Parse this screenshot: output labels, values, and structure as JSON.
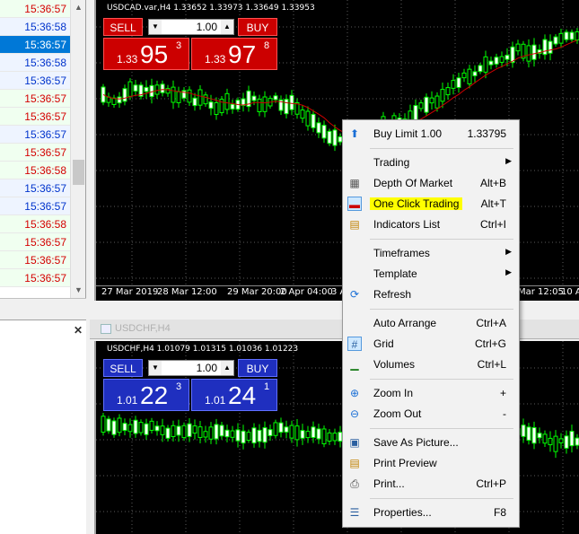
{
  "time_list": [
    {
      "time": "15:36:57",
      "color": "red"
    },
    {
      "time": "15:36:58",
      "color": "blue"
    },
    {
      "time": "15:36:57",
      "color": "selected"
    },
    {
      "time": "15:36:58",
      "color": "blue"
    },
    {
      "time": "15:36:57",
      "color": "blue"
    },
    {
      "time": "15:36:57",
      "color": "red"
    },
    {
      "time": "15:36:57",
      "color": "red"
    },
    {
      "time": "15:36:57",
      "color": "blue"
    },
    {
      "time": "15:36:57",
      "color": "red"
    },
    {
      "time": "15:36:58",
      "color": "red"
    },
    {
      "time": "15:36:57",
      "color": "blue"
    },
    {
      "time": "15:36:57",
      "color": "blue"
    },
    {
      "time": "15:36:58",
      "color": "red"
    },
    {
      "time": "15:36:57",
      "color": "red"
    },
    {
      "time": "15:36:57",
      "color": "red"
    },
    {
      "time": "15:36:57",
      "color": "red"
    }
  ],
  "chart1": {
    "title": "USDCAD.var,H4  1.33652 1.33973 1.33649 1.33953",
    "sell_label": "SELL",
    "buy_label": "BUY",
    "lots": "1.00",
    "sell_prefix": "1.33",
    "sell_big": "95",
    "sell_sup": "3",
    "buy_prefix": "1.33",
    "buy_big": "97",
    "buy_sup": "8",
    "x_ticks": [
      "27 Mar 2019",
      "28 Mar 12:00",
      "29 Mar 20:00",
      "2 Apr 04:00",
      "3 A",
      "Mar 12:05",
      "10 Ap"
    ]
  },
  "chart2": {
    "window_title": "USDCHF,H4",
    "title": "USDCHF,H4  1.01079 1.01315 1.01036 1.01223",
    "sell_label": "SELL",
    "buy_label": "BUY",
    "lots": "1.00",
    "sell_prefix": "1.01",
    "sell_big": "22",
    "sell_sup": "3",
    "buy_prefix": "1.01",
    "buy_big": "24",
    "buy_sup": "1"
  },
  "context_menu": {
    "items": [
      {
        "label": "Buy Limit 1.00",
        "shortcut": "1.33795",
        "icon": "arrow-up-icon"
      },
      {
        "label": "Trading",
        "submenu": true
      },
      {
        "label": "Depth Of Market",
        "shortcut": "Alt+B",
        "icon": "depth-of-market-icon"
      },
      {
        "label": "One Click Trading",
        "shortcut": "Alt+T",
        "icon": "one-click-trading-icon",
        "highlighted": true
      },
      {
        "label": "Indicators List",
        "shortcut": "Ctrl+I",
        "icon": "indicators-list-icon"
      },
      {
        "label": "Timeframes",
        "submenu": true
      },
      {
        "label": "Template",
        "submenu": true
      },
      {
        "label": "Refresh",
        "icon": "refresh-icon"
      },
      {
        "label": "Auto Arrange",
        "shortcut": "Ctrl+A"
      },
      {
        "label": "Grid",
        "shortcut": "Ctrl+G",
        "icon": "grid-icon"
      },
      {
        "label": "Volumes",
        "shortcut": "Ctrl+L",
        "icon": "volumes-icon"
      },
      {
        "label": "Zoom In",
        "shortcut": "+",
        "icon": "zoom-in-icon"
      },
      {
        "label": "Zoom Out",
        "shortcut": "-",
        "icon": "zoom-out-icon"
      },
      {
        "label": "Save As Picture...",
        "icon": "save-picture-icon"
      },
      {
        "label": "Print Preview",
        "icon": "print-preview-icon"
      },
      {
        "label": "Print...",
        "shortcut": "Ctrl+P",
        "icon": "print-icon"
      },
      {
        "label": "Properties...",
        "shortcut": "F8",
        "icon": "properties-icon"
      }
    ]
  },
  "colors": {
    "sell_red": "#cc0000",
    "buy_blue": "#1f2fbf",
    "candle_green": "#00ff00",
    "ma_red": "#cc0000",
    "highlight_yellow": "#ffff00"
  }
}
